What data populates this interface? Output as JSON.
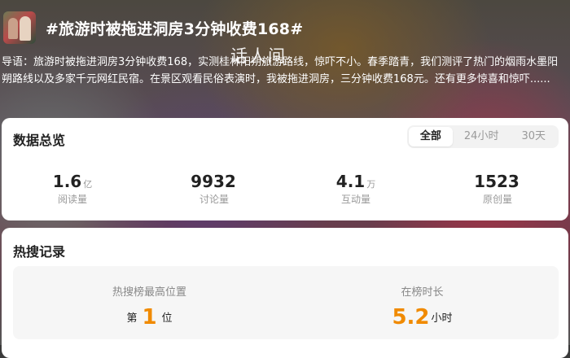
{
  "topic": {
    "title": "#旅游时被拖进洞房3分钟收费168#",
    "watermark": "话人间",
    "intro": "导语：旅游时被拖进洞房3分钟收费168，实测桂林阳朔旅游路线，惊吓不小。春季踏青，我们测评了热门的烟雨水墨阳朔路线以及多家千元网红民宿。在景区观看民俗表演时，我被拖进洞房，三分钟收费168元。还有更多惊喜和惊吓......"
  },
  "overview": {
    "title": "数据总览",
    "tabs": [
      "全部",
      "24小时",
      "30天"
    ],
    "active_tab": "全部",
    "stats": [
      {
        "value": "1.6",
        "unit": "亿",
        "label": "阅读量"
      },
      {
        "value": "9932",
        "unit": "",
        "label": "讨论量"
      },
      {
        "value": "4.1",
        "unit": "万",
        "label": "互动量"
      },
      {
        "value": "1523",
        "unit": "",
        "label": "原创量"
      }
    ]
  },
  "hot_search": {
    "title": "热搜记录",
    "peak": {
      "label": "热搜榜最高位置",
      "prefix": "第",
      "value": "1",
      "suffix": "位"
    },
    "duration": {
      "label": "在榜时长",
      "value": "5.2",
      "unit": "小时"
    }
  },
  "colors": {
    "accent": "#f08a00",
    "text_primary": "#222222",
    "text_muted": "#999999"
  }
}
